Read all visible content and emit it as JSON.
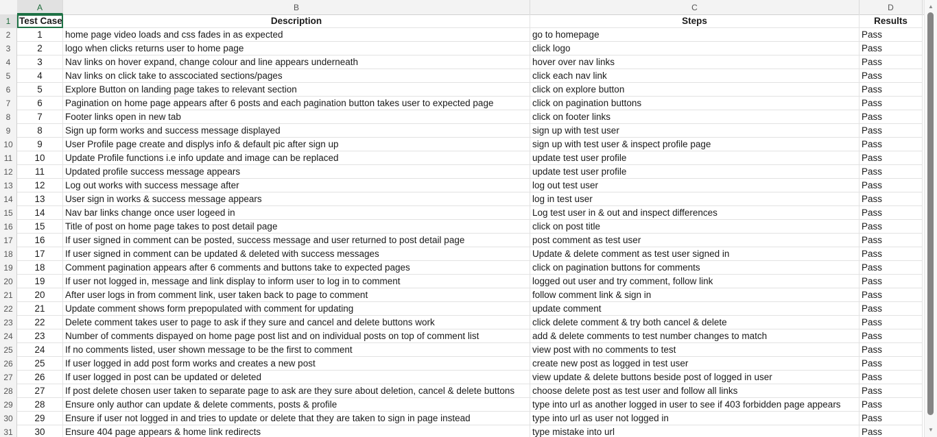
{
  "columns": [
    "A",
    "B",
    "C",
    "D"
  ],
  "header": {
    "row_num": "1",
    "test_case": "Test Case",
    "description": "Description",
    "steps": "Steps",
    "results": "Results"
  },
  "rows": [
    {
      "n": "2",
      "tc": "1",
      "desc": "home page video loads and css fades in as expected",
      "steps": "go to homepage",
      "res": "Pass"
    },
    {
      "n": "3",
      "tc": "2",
      "desc": "logo when clicks returns user to home page",
      "steps": "click logo",
      "res": "Pass"
    },
    {
      "n": "4",
      "tc": "3",
      "desc": "Nav links on hover expand, change colour and line appears underneath",
      "steps": "hover over nav links",
      "res": "Pass"
    },
    {
      "n": "5",
      "tc": "4",
      "desc": "Nav links on click take to asscociated sections/pages",
      "steps": "click each nav link",
      "res": "Pass"
    },
    {
      "n": "6",
      "tc": "5",
      "desc": "Explore Button on landing page takes to relevant section",
      "steps": "click on explore button",
      "res": "Pass"
    },
    {
      "n": "7",
      "tc": "6",
      "desc": "Pagination on home page appears after 6 posts and each pagination button takes user to expected page",
      "steps": "click on pagination buttons",
      "res": "Pass"
    },
    {
      "n": "8",
      "tc": "7",
      "desc": "Footer links open in new tab",
      "steps": "click on footer links",
      "res": "Pass"
    },
    {
      "n": "9",
      "tc": "8",
      "desc": "Sign up form works and success message displayed",
      "steps": "sign up with test user",
      "res": "Pass"
    },
    {
      "n": "10",
      "tc": "9",
      "desc": "User Profile page create and displys info & default pic after sign up",
      "steps": "sign up with test user & inspect profile page",
      "res": "Pass"
    },
    {
      "n": "11",
      "tc": "10",
      "desc": "Update Profile functions i.e info update and image can be replaced",
      "steps": "update test user profile",
      "res": "Pass"
    },
    {
      "n": "12",
      "tc": "11",
      "desc": "Updated profile success message appears",
      "steps": "update test user profile",
      "res": "Pass"
    },
    {
      "n": "13",
      "tc": "12",
      "desc": "Log out works with success message after",
      "steps": "log out test user",
      "res": "Pass"
    },
    {
      "n": "14",
      "tc": "13",
      "desc": "User sign in works & success message appears",
      "steps": "log in test user",
      "res": "Pass"
    },
    {
      "n": "15",
      "tc": "14",
      "desc": "Nav bar links change once user logeed in",
      "steps": "Log test user in & out and inspect differences",
      "res": "Pass"
    },
    {
      "n": "16",
      "tc": "15",
      "desc": "Title of post on home page takes to post detail page",
      "steps": "click on post title",
      "res": "Pass"
    },
    {
      "n": "17",
      "tc": "16",
      "desc": "If user signed in comment can be posted, success message and user returned to post detail page",
      "steps": "post comment as test user",
      "res": "Pass"
    },
    {
      "n": "18",
      "tc": "17",
      "desc": "If user signed in comment can be updated & deleted with success messages",
      "steps": "Update & delete comment as test user signed in",
      "res": "Pass"
    },
    {
      "n": "19",
      "tc": "18",
      "desc": "Comment pagination appears after 6 comments and buttons take to expected pages",
      "steps": "click on pagination buttons for comments",
      "res": "Pass"
    },
    {
      "n": "20",
      "tc": "19",
      "desc": "If user not logged in, message and link display to inform user to log in to comment",
      "steps": "logged out user and try comment, follow link",
      "res": "Pass"
    },
    {
      "n": "21",
      "tc": "20",
      "desc": "After user logs in from comment link, user taken back to page to comment",
      "steps": "follow comment link & sign in",
      "res": "Pass"
    },
    {
      "n": "22",
      "tc": "21",
      "desc": "Update comment shows form prepopulated with comment for updating",
      "steps": "update comment",
      "res": "Pass"
    },
    {
      "n": "23",
      "tc": "22",
      "desc": "Delete comment takes user to page to ask if they sure and cancel and delete buttons work",
      "steps": "click delete comment & try both cancel & delete",
      "res": "Pass"
    },
    {
      "n": "24",
      "tc": "23",
      "desc": "Number of comments dispayed on home page post list and on individual posts on top of comment list",
      "steps": "add & delete comments to test number changes to match",
      "res": "Pass"
    },
    {
      "n": "25",
      "tc": "24",
      "desc": "If no comments listed, user shown message to be the first to comment",
      "steps": "view post with no comments to test",
      "res": "Pass"
    },
    {
      "n": "26",
      "tc": "25",
      "desc": "If user logged in add post form works and creates a new post",
      "steps": "create new post as logged in test user",
      "res": "Pass"
    },
    {
      "n": "27",
      "tc": "26",
      "desc": "If user logged in post can be updated or deleted",
      "steps": "view update & delete buttons beside post of logged in user",
      "res": "Pass"
    },
    {
      "n": "28",
      "tc": "27",
      "desc": "If post delete chosen user taken to separate page to ask are they sure about deletion, cancel & delete buttons",
      "steps": "choose delete post as test user and follow all links",
      "res": "Pass"
    },
    {
      "n": "29",
      "tc": "28",
      "desc": "Ensure only author can update & delete comments, posts & profile",
      "steps": "type into url as another logged in user to see if 403 forbidden page appears",
      "res": "Pass"
    },
    {
      "n": "30",
      "tc": "29",
      "desc": "Ensure if user not logged in and tries to update or delete that they are taken to sign in page instead",
      "steps": "type into url as user not logged in",
      "res": "Pass"
    },
    {
      "n": "31",
      "tc": "30",
      "desc": "Ensure 404 page appears & home link redirects",
      "steps": "type mistake into url",
      "res": "Pass"
    }
  ],
  "scrollbar": {
    "up_icon": "triangle-up",
    "down_icon": "triangle-down"
  }
}
